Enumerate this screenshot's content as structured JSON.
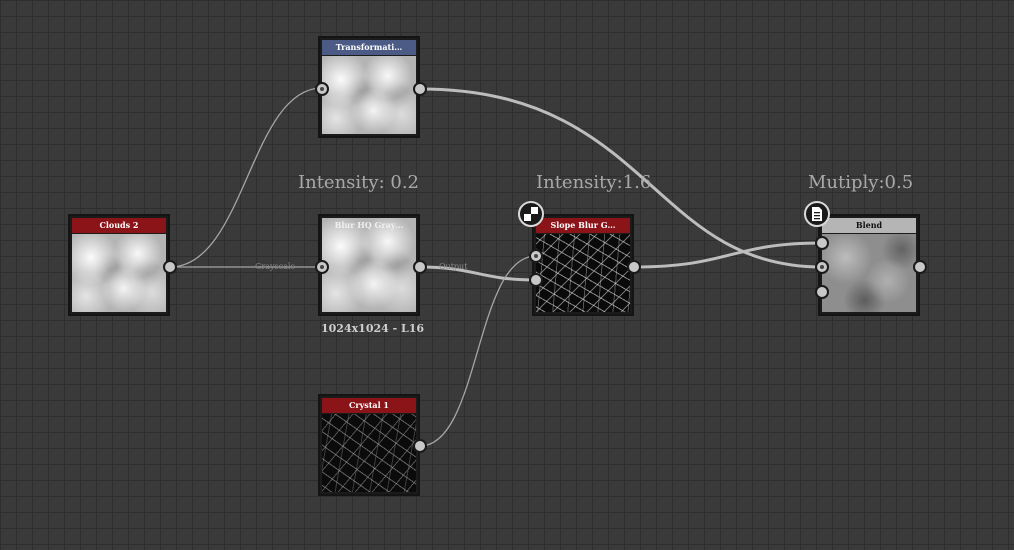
{
  "colors": {
    "background": "#3a3a3a",
    "grid_line": "#2e2e2e",
    "title_generator": "#8b1418",
    "title_transform": "#4b5b85",
    "title_blend": "#b5b5b5",
    "wire_thick": "#bdbdbd",
    "wire_thin": "#a5a5a5"
  },
  "nodes": {
    "clouds": {
      "title": "Clouds 2",
      "thumbnail": "clouds-texture"
    },
    "transform": {
      "title": "Transformati…",
      "thumbnail": "clouds-texture"
    },
    "blur": {
      "title": "Blur HQ Gray…",
      "thumbnail": "clouds-texture",
      "resolution": "1024x1024 - L16",
      "input_label": "Grayscale",
      "output_label": "Output"
    },
    "slope": {
      "title": "Slope Blur G…",
      "thumbnail": "crystal-texture",
      "badge_icon": "checker-icon"
    },
    "blend": {
      "title": "Blend",
      "thumbnail": "clouds-texture",
      "badge_icon": "document-icon"
    },
    "crystal": {
      "title": "Crystal 1",
      "thumbnail": "crystal-texture"
    }
  },
  "params": {
    "blur": "Intensity: 0.2",
    "slope": "Intensity:1.6",
    "blend": "Mutiply:0.5"
  }
}
